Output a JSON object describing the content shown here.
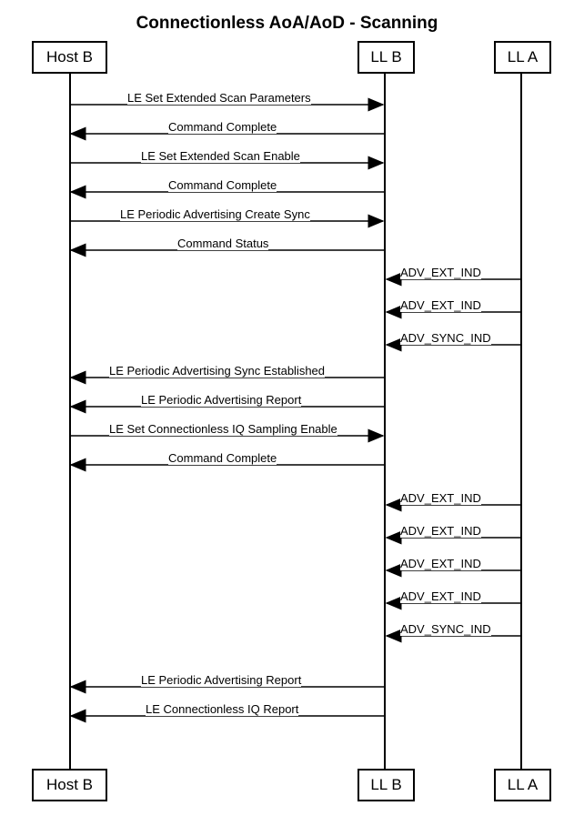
{
  "title": "Connectionless AoA/AoD - Scanning",
  "actors": {
    "hostB": "Host B",
    "llB": "LL B",
    "llA": "LL A"
  },
  "messages": {
    "m1": "LE Set Extended Scan Parameters",
    "m2": "Command Complete",
    "m3": "LE Set Extended Scan Enable",
    "m4": "Command Complete",
    "m5": "LE Periodic Advertising Create Sync",
    "m6": "Command Status",
    "m7": "ADV_EXT_IND",
    "m8": "ADV_EXT_IND",
    "m9": "ADV_SYNC_IND",
    "m10": "LE Periodic Advertising Sync Established",
    "m11": "LE Periodic Advertising Report",
    "m12": "LE Set Connectionless IQ Sampling Enable",
    "m13": "Command Complete",
    "m14": "ADV_EXT_IND",
    "m15": "ADV_EXT_IND",
    "m16": "ADV_EXT_IND",
    "m17": "ADV_EXT_IND",
    "m18": "ADV_SYNC_IND",
    "m19": "LE Periodic Advertising Report",
    "m20": "LE Connectionless IQ Report"
  }
}
